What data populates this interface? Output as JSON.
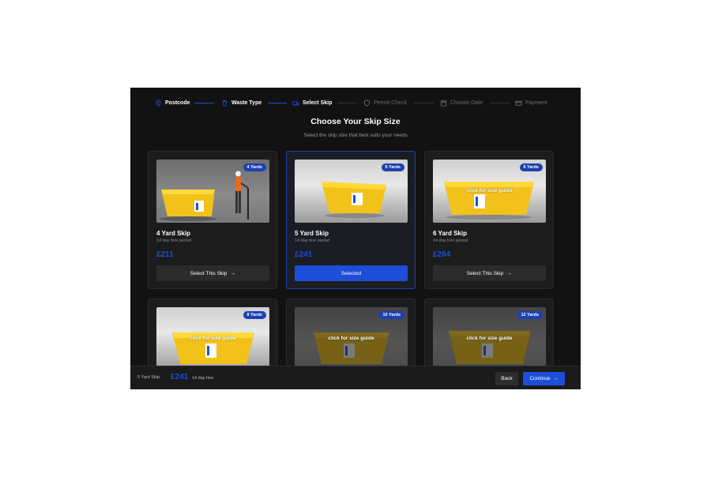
{
  "steps": [
    {
      "label": "Postcode",
      "icon": "map-pin-icon",
      "state": "done"
    },
    {
      "label": "Waste Type",
      "icon": "trash-icon",
      "state": "done"
    },
    {
      "label": "Select Skip",
      "icon": "truck-icon",
      "state": "active"
    },
    {
      "label": "Permit Check",
      "icon": "shield-icon",
      "state": "pending"
    },
    {
      "label": "Choose Date",
      "icon": "calendar-icon",
      "state": "pending"
    },
    {
      "label": "Payment",
      "icon": "card-icon",
      "state": "pending"
    }
  ],
  "heading": {
    "title": "Choose Your Skip Size",
    "subtitle": "Select the skip size that best suits your needs"
  },
  "cards": [
    {
      "badge": "4 Yards",
      "title": "4 Yard Skip",
      "hire": "14 day hire period",
      "price": "£211",
      "button": "Select This Skip",
      "guide": ""
    },
    {
      "badge": "5 Yards",
      "title": "5 Yard Skip",
      "hire": "14 day hire period",
      "price": "£241",
      "button": "Selected",
      "guide": ""
    },
    {
      "badge": "6 Yards",
      "title": "6 Yard Skip",
      "hire": "14 day hire period",
      "price": "£264",
      "button": "Select This Skip",
      "guide": "click for size guide"
    },
    {
      "badge": "8 Yards",
      "title": "",
      "hire": "",
      "price": "",
      "button": "",
      "guide": "click for size guide"
    },
    {
      "badge": "10 Yards",
      "title": "",
      "hire": "",
      "price": "",
      "button": "",
      "guide": "click for size guide"
    },
    {
      "badge": "12 Yards",
      "title": "",
      "hire": "",
      "price": "",
      "button": "",
      "guide": "click for size guide"
    }
  ],
  "footer": {
    "skip": "5 Yard Skip",
    "price": "£241",
    "hire": "14 day hire",
    "back": "Back",
    "continue": "Continue"
  },
  "colors": {
    "accent": "#1d4ed8",
    "background": "#121212",
    "skip": "#f5c518"
  }
}
